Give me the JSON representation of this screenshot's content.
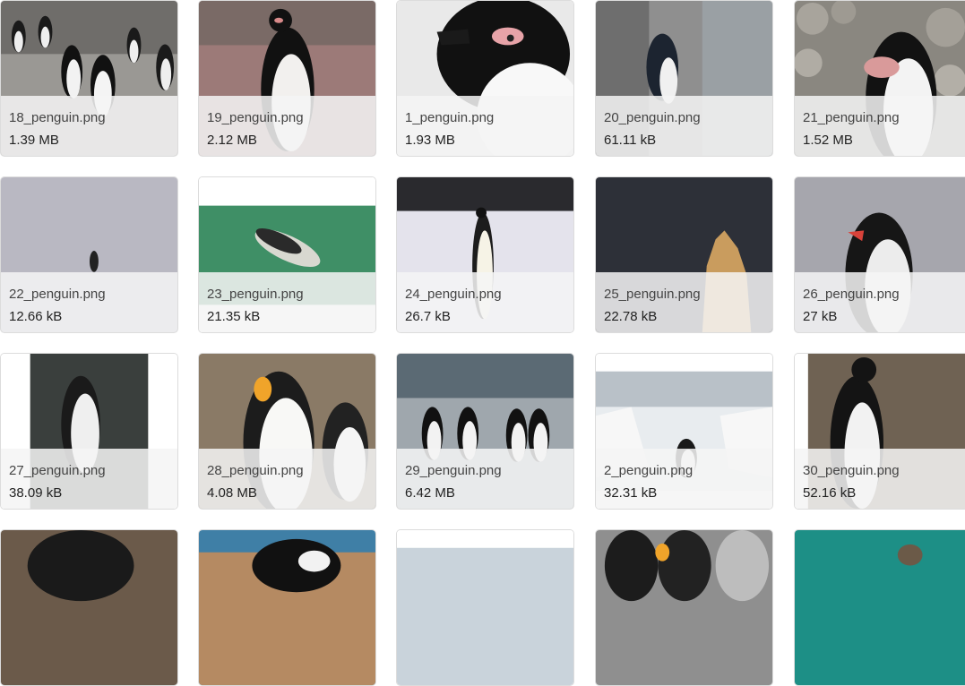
{
  "files": [
    {
      "name": "18_penguin.png",
      "size": "1.39 MB"
    },
    {
      "name": "19_penguin.png",
      "size": "2.12 MB"
    },
    {
      "name": "1_penguin.png",
      "size": "1.93 MB"
    },
    {
      "name": "20_penguin.png",
      "size": "61.11 kB"
    },
    {
      "name": "21_penguin.png",
      "size": "1.52 MB"
    },
    {
      "name": "22_penguin.png",
      "size": "12.66 kB"
    },
    {
      "name": "23_penguin.png",
      "size": "21.35 kB"
    },
    {
      "name": "24_penguin.png",
      "size": "26.7 kB"
    },
    {
      "name": "25_penguin.png",
      "size": "22.78 kB"
    },
    {
      "name": "26_penguin.png",
      "size": "27 kB"
    },
    {
      "name": "27_penguin.png",
      "size": "38.09 kB"
    },
    {
      "name": "28_penguin.png",
      "size": "4.08 MB"
    },
    {
      "name": "29_penguin.png",
      "size": "6.42 MB"
    },
    {
      "name": "2_penguin.png",
      "size": "32.31 kB"
    },
    {
      "name": "30_penguin.png",
      "size": "52.16 kB"
    }
  ]
}
